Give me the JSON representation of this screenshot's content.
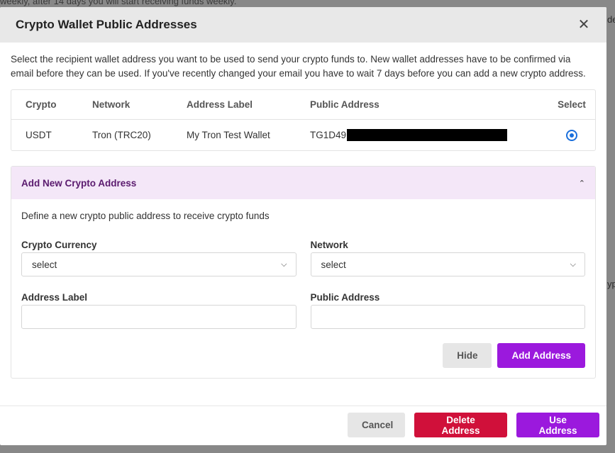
{
  "background": {
    "top_text": "weekly, after 14 days you will start receiving funds weekly.",
    "frag_right_top": "de",
    "frag_right_mid": "ypi"
  },
  "modal": {
    "title": "Crypto Wallet Public Addresses",
    "close_glyph": "✕",
    "intro": "Select the recipient wallet address you want to be used to send your crypto funds to. New wallet addresses have to be confirmed via email before they can be used. If you've recently changed your email you have to wait 7 days before you can add a new crypto address."
  },
  "table": {
    "headers": [
      "Crypto",
      "Network",
      "Address Label",
      "Public Address",
      "Select"
    ],
    "rows": [
      {
        "crypto": "USDT",
        "network": "Tron (TRC20)",
        "label": "My Tron Test Wallet",
        "address_prefix": "TG1D49",
        "selected": true
      }
    ]
  },
  "add_panel": {
    "title": "Add New Crypto Address",
    "chevron": "⌃",
    "description": "Define a new crypto public address to receive crypto funds",
    "crypto_currency_label": "Crypto Currency",
    "crypto_currency_value": "select",
    "network_label": "Network",
    "network_value": "select",
    "address_label_label": "Address Label",
    "address_label_value": "",
    "public_address_label": "Public Address",
    "public_address_value": "",
    "hide_button": "Hide",
    "add_button": "Add Address"
  },
  "footer": {
    "cancel": "Cancel",
    "delete": "Delete Address",
    "use": "Use Address"
  },
  "colors": {
    "accent_purple": "#9b19dd",
    "danger_red": "#d0103a",
    "panel_header_bg": "#f4e7f8",
    "radio_blue": "#1a6fdc"
  }
}
